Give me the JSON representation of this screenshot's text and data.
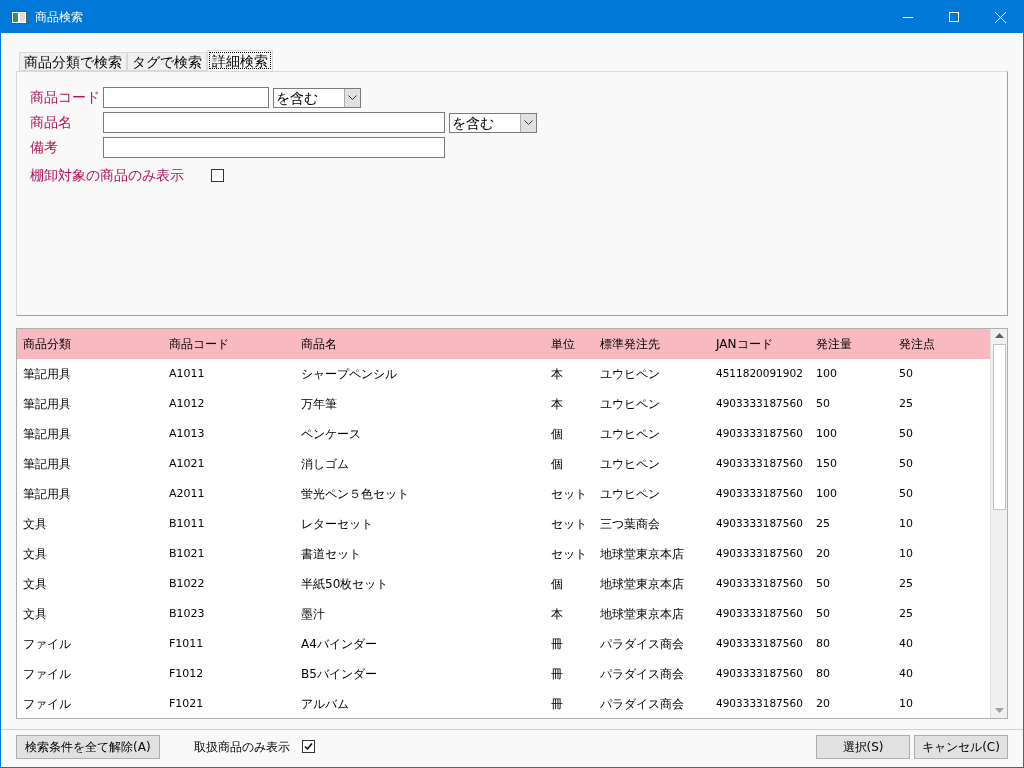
{
  "window": {
    "title": "商品検索"
  },
  "tabs": [
    {
      "label": "商品分類で検索",
      "selected": false
    },
    {
      "label": "タグで検索",
      "selected": false
    },
    {
      "label": "詳細検索",
      "selected": true
    }
  ],
  "filters": [
    {
      "kind": "text-select",
      "label": "商品コード",
      "value_option": "を含む",
      "wide": false
    },
    {
      "kind": "text-select",
      "label": "商品名",
      "value_option": "を含む",
      "wide": true
    },
    {
      "kind": "text",
      "label": "備考",
      "wide": true
    },
    {
      "kind": "checkbox",
      "label": "棚卸対象の商品のみ表示",
      "checked": false
    }
  ],
  "table": {
    "columns": [
      "商品分類",
      "商品コード",
      "商品名",
      "単位",
      "標準発注先",
      "JANコード",
      "発注量",
      "発注点"
    ],
    "rows": [
      [
        "筆記用具",
        "A1011",
        "シャープペンシル",
        "本",
        "ユウヒペン",
        "4511820091902",
        "100",
        "50"
      ],
      [
        "筆記用具",
        "A1012",
        "万年筆",
        "本",
        "ユウヒペン",
        "4903333187560",
        "50",
        "25"
      ],
      [
        "筆記用具",
        "A1013",
        "ペンケース",
        "個",
        "ユウヒペン",
        "4903333187560",
        "100",
        "50"
      ],
      [
        "筆記用具",
        "A1021",
        "消しゴム",
        "個",
        "ユウヒペン",
        "4903333187560",
        "150",
        "50"
      ],
      [
        "筆記用具",
        "A2011",
        "蛍光ペン５色セット",
        "セット",
        "ユウヒペン",
        "4903333187560",
        "100",
        "50"
      ],
      [
        "文具",
        "B1011",
        "レターセット",
        "セット",
        "三つ葉商会",
        "4903333187560",
        "25",
        "10"
      ],
      [
        "文具",
        "B1021",
        "書道セット",
        "セット",
        "地球堂東京本店",
        "4903333187560",
        "20",
        "10"
      ],
      [
        "文具",
        "B1022",
        "半紙50枚セット",
        "個",
        "地球堂東京本店",
        "4903333187560",
        "50",
        "25"
      ],
      [
        "文具",
        "B1023",
        "墨汁",
        "本",
        "地球堂東京本店",
        "4903333187560",
        "50",
        "25"
      ],
      [
        "ファイル",
        "F1011",
        "A4バインダー",
        "冊",
        "パラダイス商会",
        "4903333187560",
        "80",
        "40"
      ],
      [
        "ファイル",
        "F1012",
        "B5バインダー",
        "冊",
        "パラダイス商会",
        "4903333187560",
        "80",
        "40"
      ],
      [
        "ファイル",
        "F1021",
        "アルバム",
        "冊",
        "パラダイス商会",
        "4903333187560",
        "20",
        "10"
      ]
    ]
  },
  "footer": {
    "clear_button": "検索条件を全て解除(A)",
    "handled_only": {
      "label": "取扱商品のみ表示",
      "checked": true
    },
    "buttons": [
      "選択(S)",
      "キャンセル(C)"
    ]
  }
}
